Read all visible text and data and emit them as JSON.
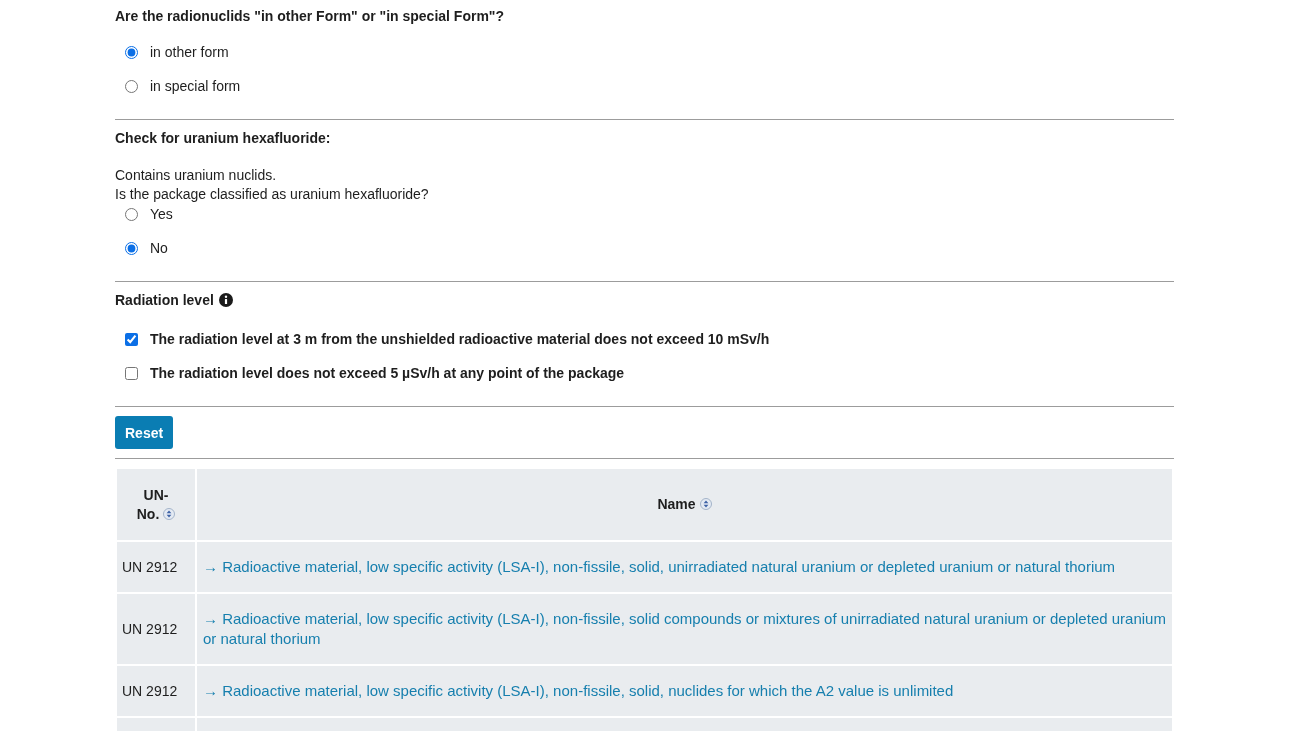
{
  "sections": [
    {
      "kind": "radio",
      "title": "Are the radionuclids \"in other Form\" or \"in special Form\"?",
      "options": [
        {
          "label": "in other form",
          "selected": true
        },
        {
          "label": "in special form",
          "selected": false
        }
      ]
    },
    {
      "kind": "radio",
      "title": "Check for uranium hexafluoride:",
      "intro": [
        "Contains uranium nuclids.",
        "Is the package classified as uranium hexafluoride?"
      ],
      "options": [
        {
          "label": "Yes",
          "selected": false
        },
        {
          "label": "No",
          "selected": true
        }
      ]
    },
    {
      "kind": "checkbox",
      "title": "Radiation level",
      "info_icon": true,
      "options": [
        {
          "label": "The radiation level at 3 m from the unshielded radioactive material does not exceed 10 mSv/h",
          "checked": true
        },
        {
          "label": "The radiation level does not exceed 5 µSv/h at any point of the package",
          "checked": false
        }
      ]
    }
  ],
  "reset_button": "Reset",
  "table": {
    "columns": [
      {
        "label": "UN-No.",
        "sortable": true
      },
      {
        "label": "Name",
        "sortable": true
      }
    ],
    "rows": [
      {
        "un_no": "UN 2912",
        "name": "→ Radioactive material, low specific activity (LSA-I), non-fissile, solid, unirradiated natural uranium or depleted uranium or natural thorium"
      },
      {
        "un_no": "UN 2912",
        "name": "→ Radioactive material, low specific activity (LSA-I), non-fissile, solid compounds or mixtures of unirradiated natural uranium or depleted uranium or natural thorium"
      },
      {
        "un_no": "UN 2912",
        "name": "→ Radioactive material, low specific activity (LSA-I), non-fissile, solid, nuclides for which the A2 value is unlimited"
      }
    ]
  }
}
